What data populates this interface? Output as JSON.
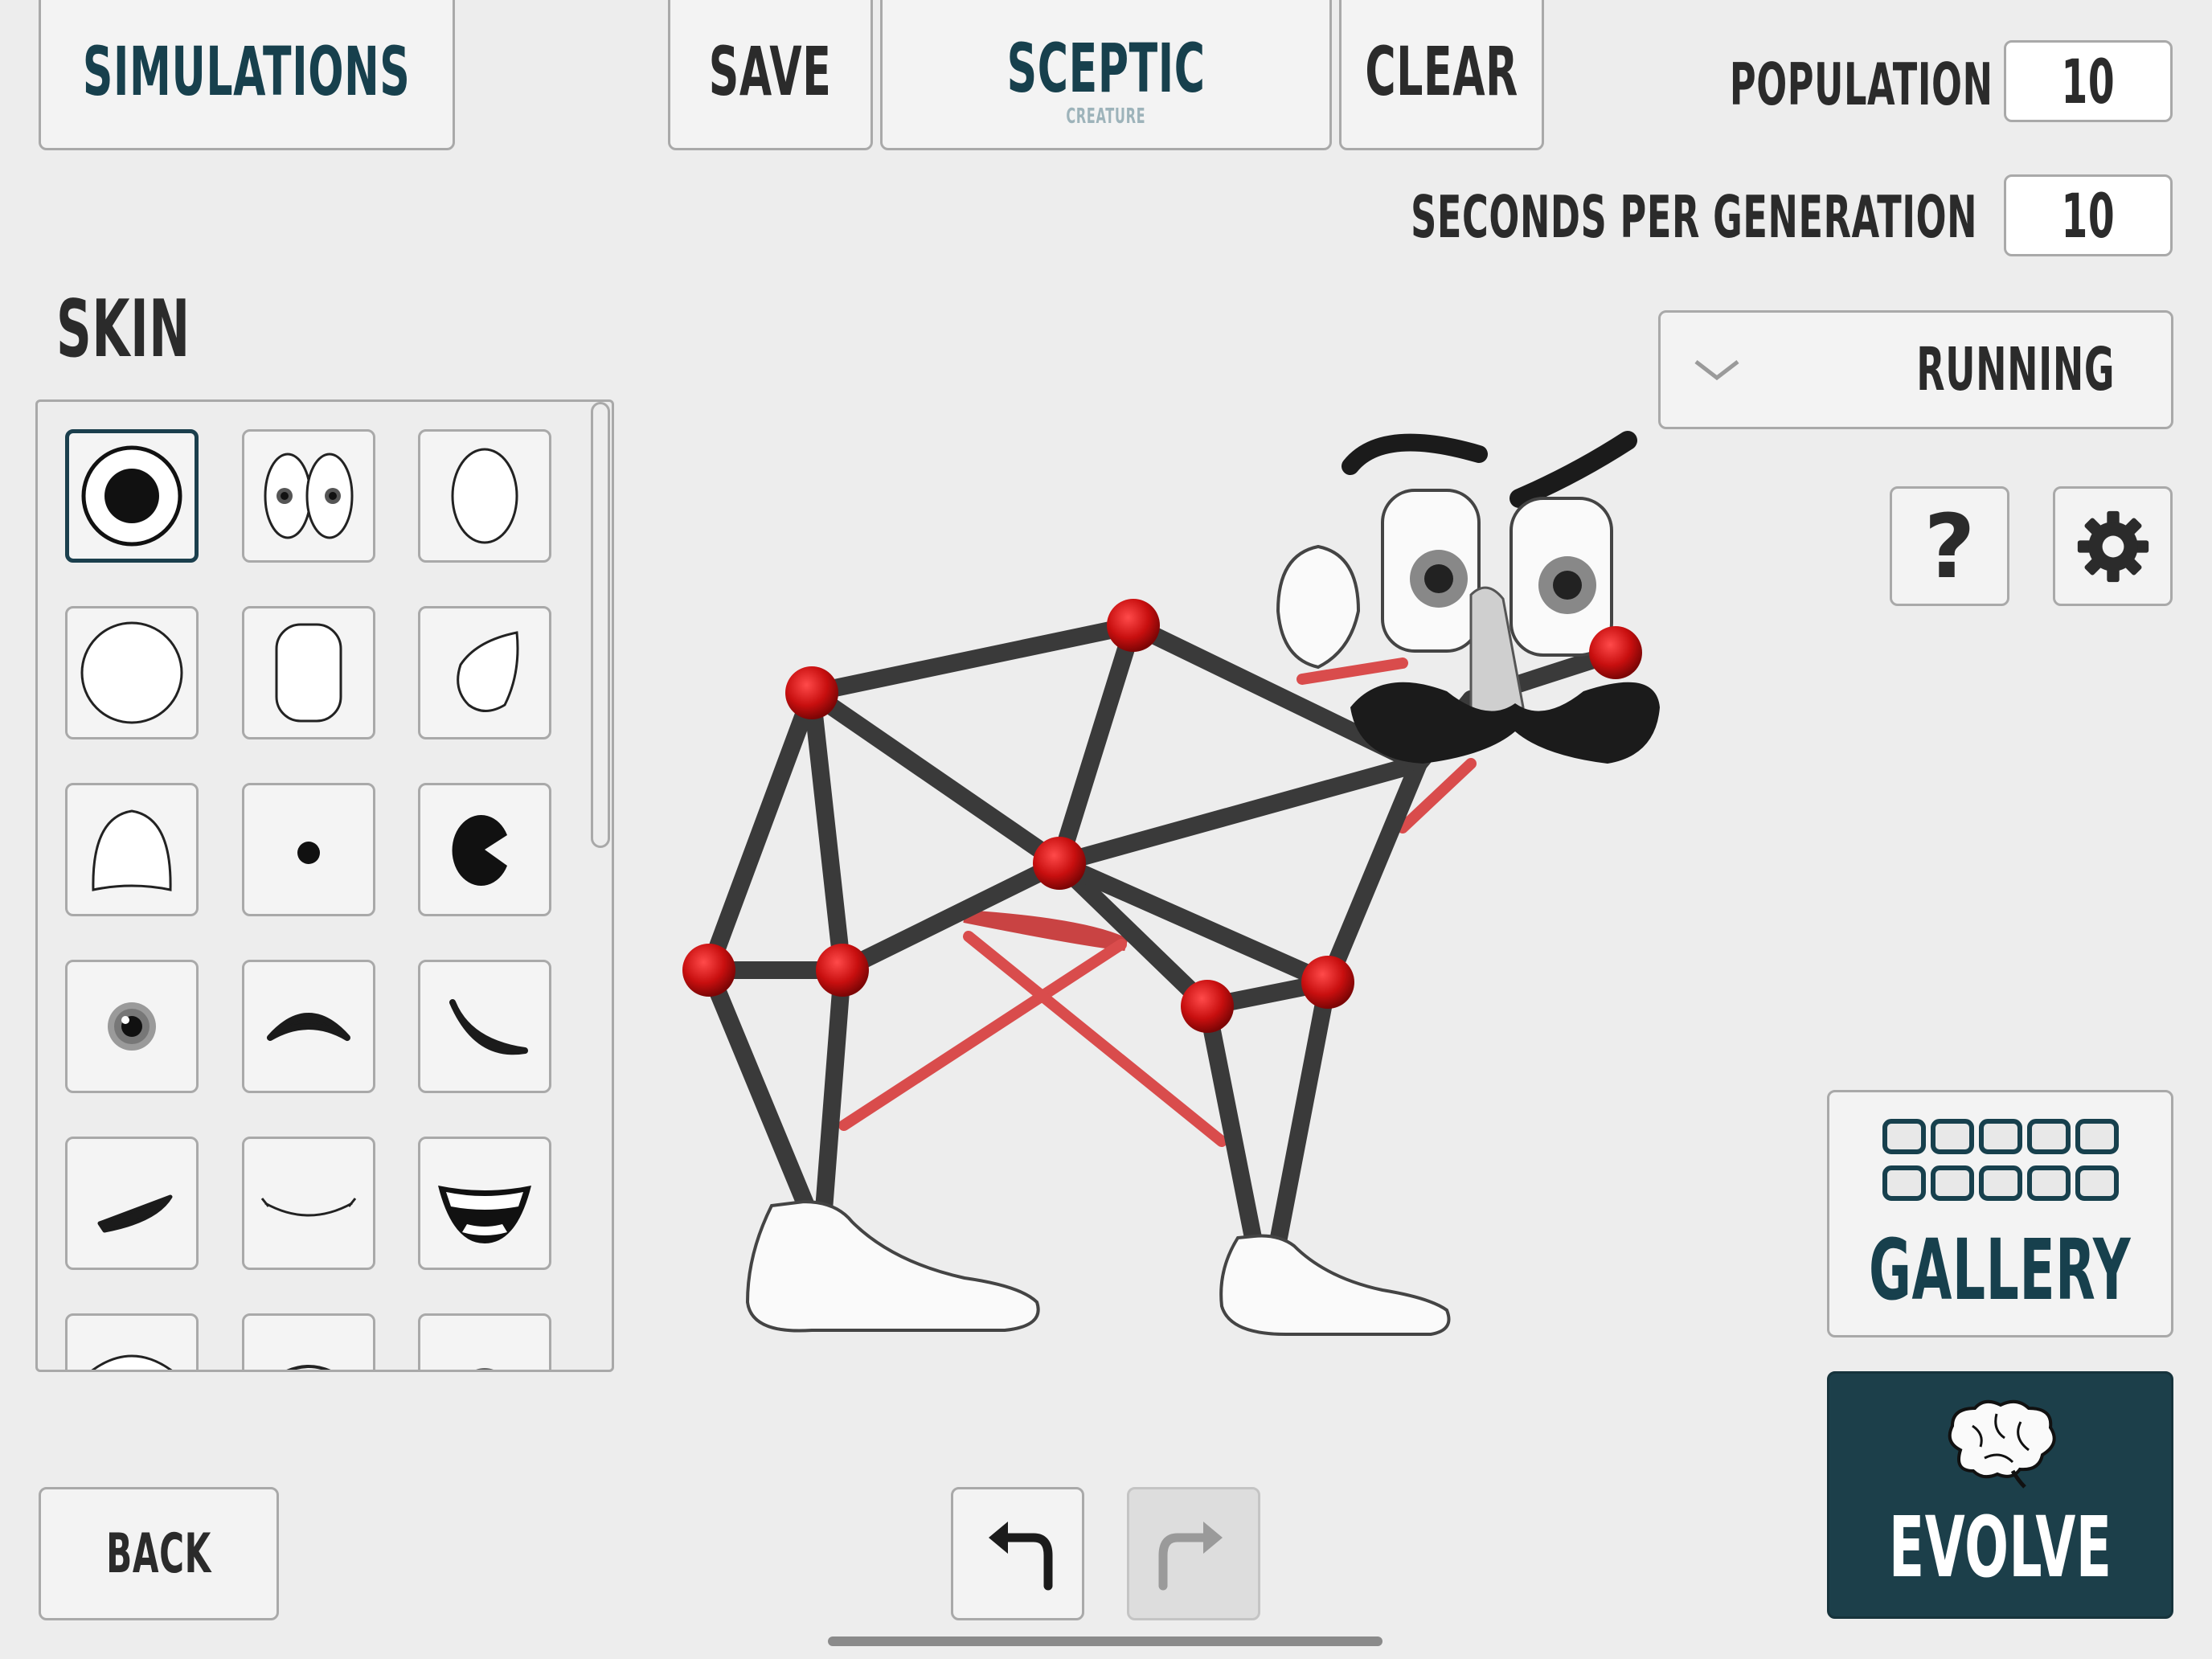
{
  "top_bar": {
    "simulations_label": "SIMULATIONS",
    "save_label": "SAVE",
    "creature_name": "SCEPTIC",
    "creature_sublabel": "CREATURE",
    "clear_label": "CLEAR"
  },
  "settings": {
    "population_label": "POPULATION",
    "population_value": "10",
    "seconds_label": "SECONDS PER GENERATION",
    "seconds_value": "10",
    "task_selected": "RUNNING"
  },
  "skin": {
    "heading": "SKIN",
    "items": [
      "big-eye-icon",
      "cartoon-eyes-icon",
      "oval-eye-icon",
      "round-eye-icon",
      "rounded-rect-eye-icon",
      "tilted-eye-icon",
      "half-eye-icon",
      "dot-pupil-icon",
      "pacman-pupil-icon",
      "realistic-iris-icon",
      "eyebrow-icon",
      "angled-eyebrow-icon",
      "flat-brow-icon",
      "smile-mouth-icon",
      "grin-mouth-icon",
      "teeth-mouth-icon",
      "closed-mouth-icon",
      "lips-icon"
    ]
  },
  "actions": {
    "help_label": "?",
    "gallery_label": "GALLERY",
    "evolve_label": "EVOLVE",
    "back_label": "BACK"
  },
  "colors": {
    "background": "#ededed",
    "accent_teal": "#17404d",
    "evolve_bg": "#1c3f4a",
    "joint_red": "#c80f0f",
    "muscle_red": "#d84444",
    "bone": "#3a3a3a"
  }
}
